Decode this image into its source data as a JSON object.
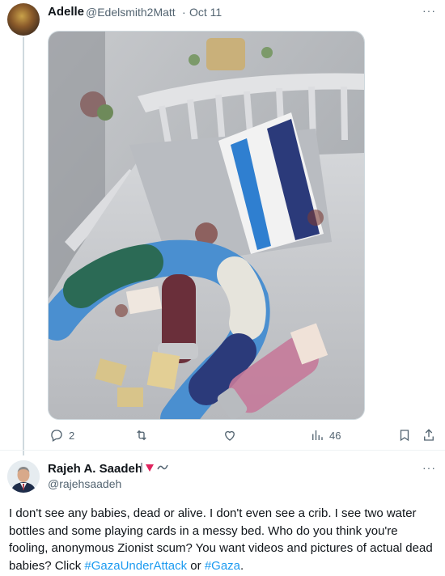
{
  "tweet1": {
    "author_name": "Adelle",
    "author_handle": "@Edelsmith2Matt",
    "separator": "·",
    "date": "Oct 11",
    "more_label": "···",
    "stats": {
      "replies": "2",
      "views": "46"
    }
  },
  "tweet2": {
    "author_name": "Rajeh A. Saadeh",
    "author_handle": "@rajehsaadeh",
    "more_label": "···",
    "text_intro": "I don't see any babies, dead or alive. I don't even see a crib. I see two water bottles and some playing cards in a messy bed. Who do you think you're fooling, anonymous Zionist scum? You want videos and pictures of actual dead babies? Click ",
    "hashtag1": "#GazaUnderAttack",
    "text_or": " or ",
    "hashtag2": "#Gaza",
    "text_end": "."
  },
  "colors": {
    "text": "#0f1419",
    "secondary": "#536471",
    "link": "#1d9bf0",
    "border": "#cfd9de"
  },
  "icons": [
    "reply-icon",
    "retweet-icon",
    "like-icon",
    "views-icon",
    "bookmark-icon",
    "share-icon"
  ]
}
